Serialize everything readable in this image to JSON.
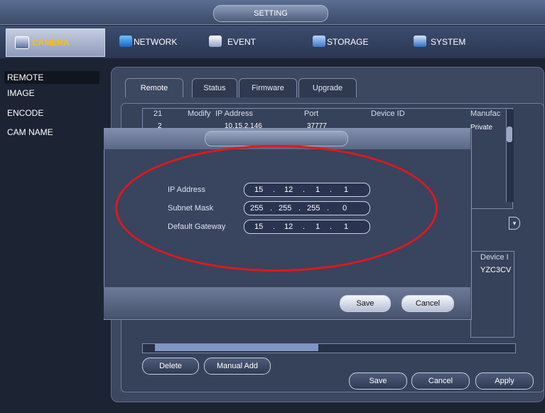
{
  "title": "SETTING",
  "menu": {
    "camera": "CAMERA",
    "network": "NETWORK",
    "event": "EVENT",
    "storage": "STORAGE",
    "system": "SYSTEM"
  },
  "leftnav": [
    "REMOTE",
    "IMAGE",
    "ENCODE",
    "CAM NAME"
  ],
  "tabs": [
    "Remote",
    "Status",
    "Firmware",
    "Upgrade"
  ],
  "table": {
    "headers": [
      "21",
      "Modify",
      "IP Address",
      "Port",
      "Device ID",
      "Manufac"
    ],
    "row": {
      "num": "2",
      "ip": "10.15.2.146",
      "port": "37777",
      "manufacturer": "Private"
    }
  },
  "added": {
    "header": "Device I",
    "value": "YZC3CV"
  },
  "dialog": {
    "fields": [
      {
        "label": "IP Address",
        "parts": [
          "15",
          "12",
          "1",
          "1"
        ]
      },
      {
        "label": "Subnet Mask",
        "parts": [
          "255",
          "255",
          "255",
          "0"
        ]
      },
      {
        "label": "Default Gateway",
        "parts": [
          "15",
          "12",
          "1",
          "1"
        ]
      }
    ],
    "save": "Save",
    "cancel": "Cancel"
  },
  "buttons": {
    "delete": "Delete",
    "manual_add": "Manual Add",
    "save": "Save",
    "cancel": "Cancel",
    "apply": "Apply"
  },
  "highlight_color": "#e0181c",
  "active_color": "#f4c20d"
}
